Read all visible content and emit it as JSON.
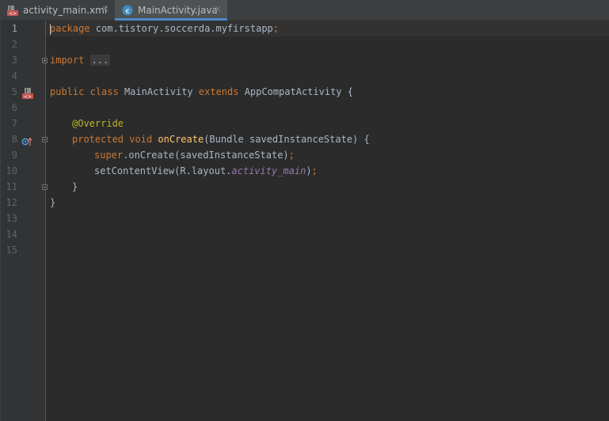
{
  "tabs": [
    {
      "label": "activity_main.xml",
      "icon": "xml-layout-icon",
      "active": false
    },
    {
      "label": "MainActivity.java",
      "icon": "java-class-icon",
      "active": true
    }
  ],
  "tab_close_glyph": "×",
  "gutter": {
    "line_numbers": [
      "1",
      "2",
      "3",
      "4",
      "5",
      "6",
      "7",
      "8",
      "9",
      "10",
      "11",
      "12",
      "13",
      "14",
      "15"
    ],
    "current_line": "1"
  },
  "code": {
    "l1_kw": "package",
    "l1_rest": " com.tistory.soccerda.myfirstapp",
    "l1_semi": ";",
    "l3_kw": "import",
    "l3_folded": "...",
    "l7_kw1": "public",
    "l7_kw2": "class",
    "l7_name": "MainActivity",
    "l7_kw3": "extends",
    "l7_super": "AppCompatActivity",
    "l7_brace": "{",
    "l9_anno": "@Override",
    "l10_kw1": "protected",
    "l10_kw2": "void",
    "l10_method": "onCreate",
    "l10_params": "(Bundle savedInstanceState) {",
    "l11_kw": "super",
    "l11_rest": ".onCreate(savedInstanceState)",
    "l11_semi": ";",
    "l12_pre": "setContentView(R.layout.",
    "l12_field": "activity_main",
    "l12_post": ")",
    "l12_semi": ";",
    "l13_brace": "}",
    "l14_brace": "}"
  },
  "colors": {
    "background": "#2b2b2b",
    "gutter": "#313335",
    "keyword": "#cc7832",
    "text": "#a9b7c6",
    "annotation": "#bbb529",
    "method": "#ffc66d",
    "field": "#9876aa",
    "active_tab_underline": "#4a88c7"
  }
}
